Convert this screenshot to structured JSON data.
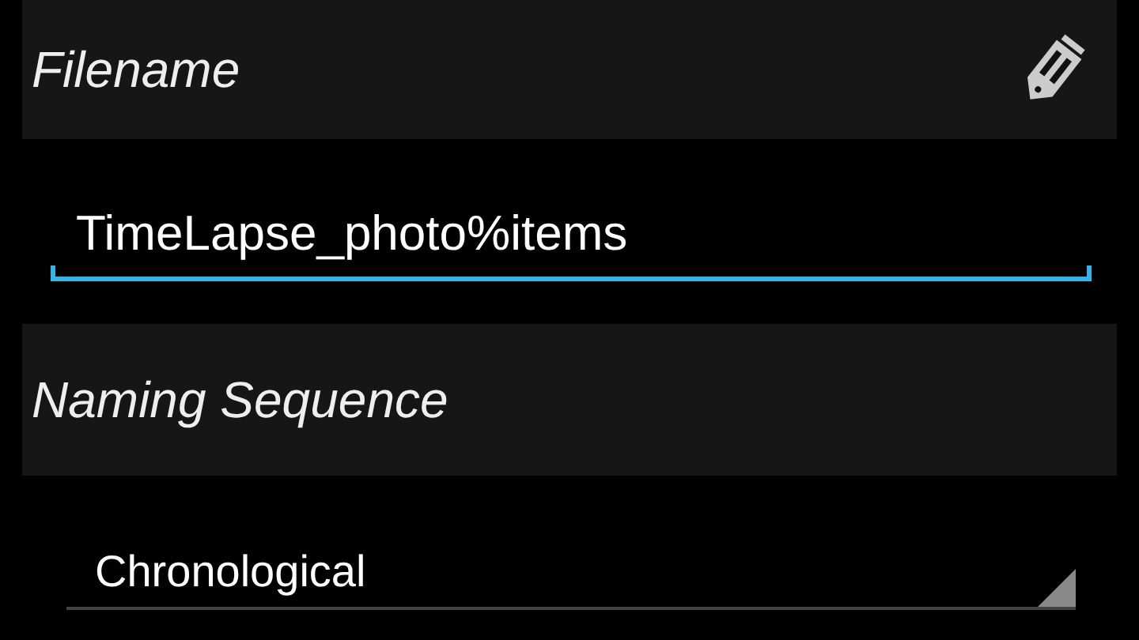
{
  "sections": [
    {
      "title": "Filename",
      "has_edit_icon": true,
      "field": {
        "kind": "text",
        "value": "TimeLapse_photo%items",
        "focused": true
      }
    },
    {
      "title": "Naming Sequence",
      "has_edit_icon": false,
      "field": {
        "kind": "spinner",
        "value": "Chronological"
      }
    }
  ]
}
